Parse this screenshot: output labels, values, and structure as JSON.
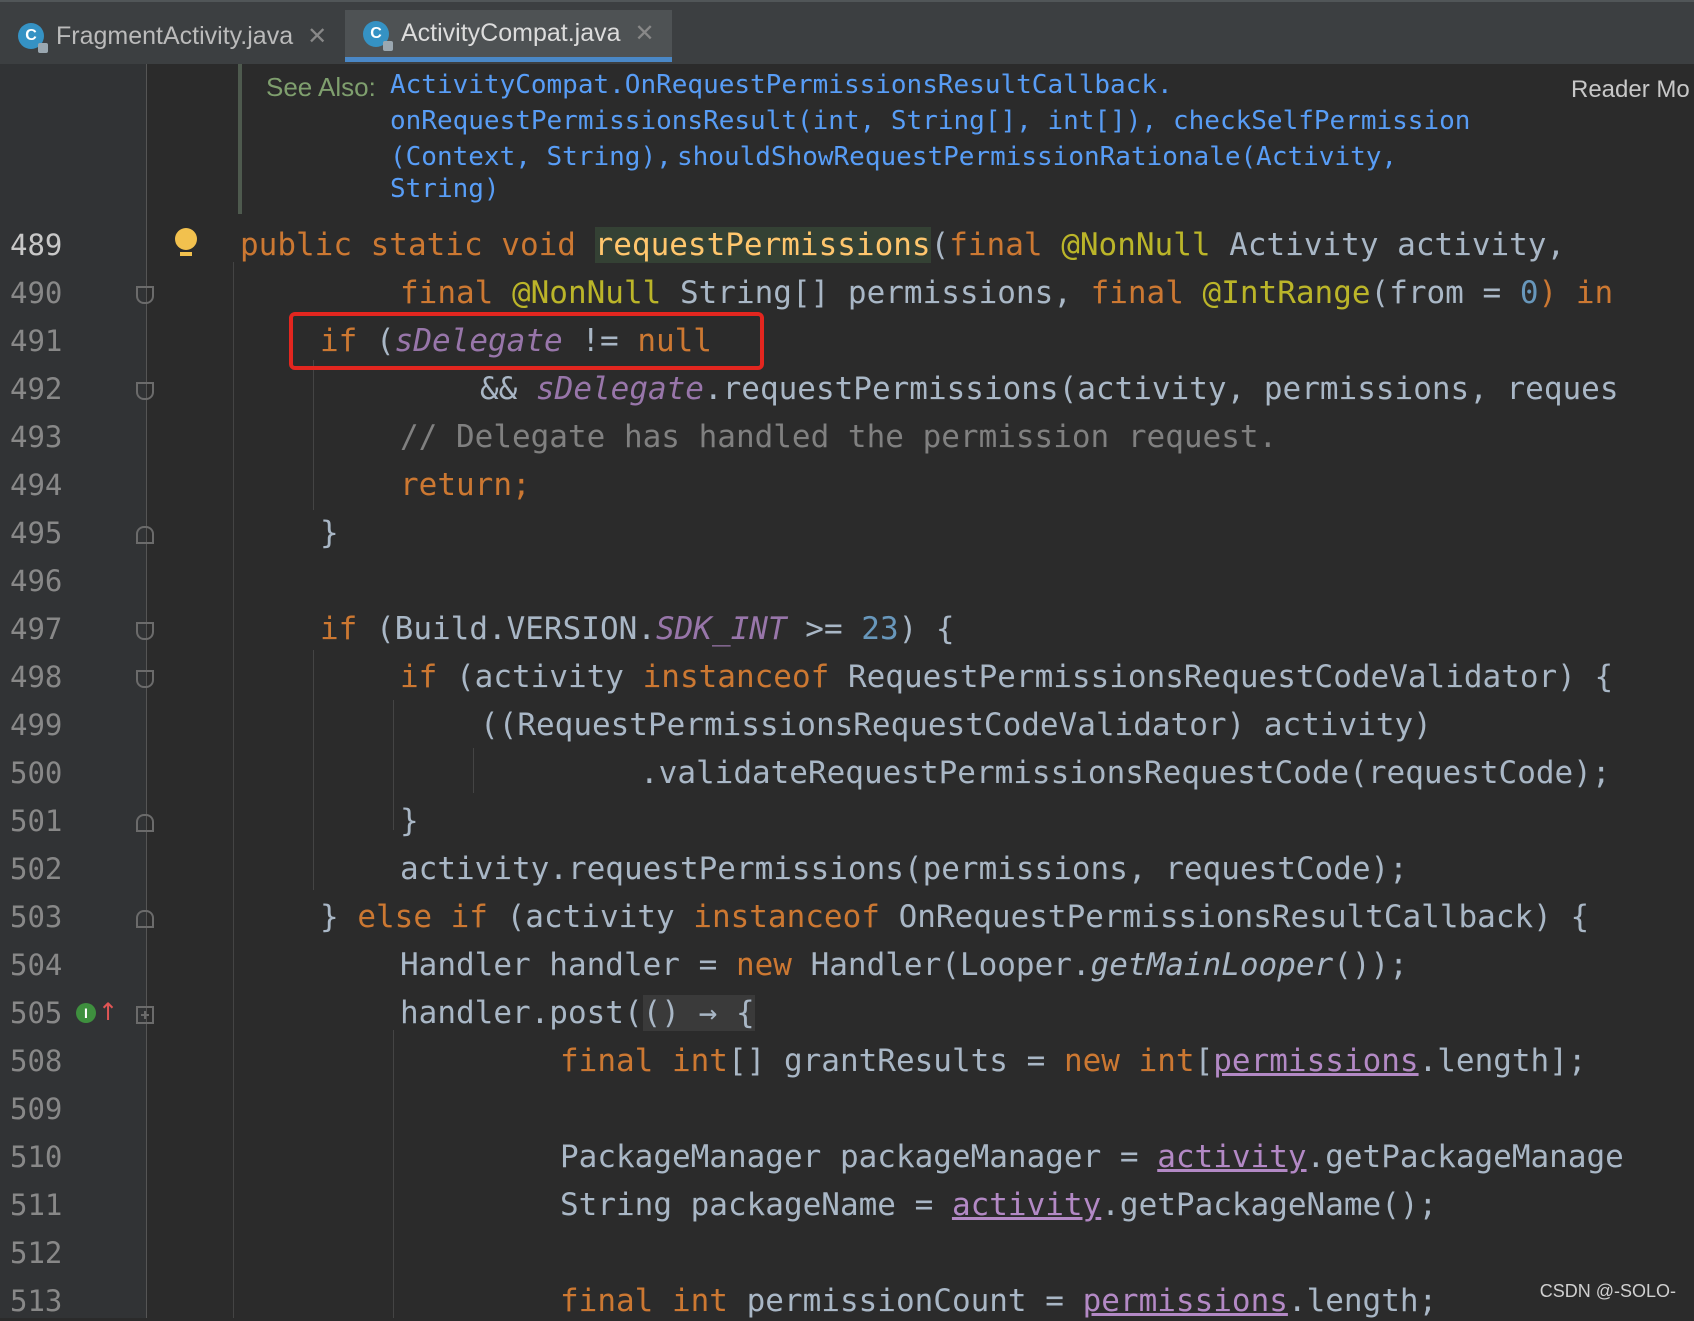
{
  "tabs": [
    {
      "label": "FragmentActivity.java",
      "active": false
    },
    {
      "label": "ActivityCompat.java",
      "active": true
    }
  ],
  "doc": {
    "see_also_label": "See Also:",
    "lines": [
      "ActivityCompat.OnRequestPermissionsResultCallback.",
      "onRequestPermissionsResult(int, String[], int[]),",
      "checkSelfPermission",
      "(Context, String),",
      "shouldShowRequestPermissionRationale(Activity,",
      "String)"
    ],
    "reader_mode": "Reader Mo"
  },
  "line_numbers": [
    "489",
    "490",
    "491",
    "492",
    "493",
    "494",
    "495",
    "496",
    "497",
    "498",
    "499",
    "500",
    "501",
    "502",
    "503",
    "504",
    "505",
    "508",
    "509",
    "510",
    "511",
    "512",
    "513"
  ],
  "code": {
    "l489": {
      "kw": "public static void ",
      "fn": "requestPermissions",
      "p1": "(",
      "kw2": "final ",
      "an": "@NonNull",
      "rest": " Activity activity,"
    },
    "l490": {
      "kw": "final ",
      "an": "@NonNull",
      "mid": " String[] permissions, ",
      "kw2": "final ",
      "an2": "@IntRange",
      "p": "(from = ",
      "num": "0",
      "rest": ") in"
    },
    "l491": {
      "kw": "if ",
      "p": "(",
      "fi": "sDelegate",
      "op": " != ",
      "kw2": "null"
    },
    "l492": {
      "op": "&& ",
      "fi": "sDelegate",
      "rest": ".requestPermissions(activity, permissions, reques"
    },
    "l493": {
      "cm": "// Delegate has handled the permission request."
    },
    "l494": {
      "kw": "return",
      "p": ";"
    },
    "l495": {
      "p": "}"
    },
    "l497": {
      "kw": "if ",
      "p": "(Build.VERSION.",
      "fi": "SDK_INT",
      "op": " >= ",
      "num": "23",
      "rest": ") {"
    },
    "l498": {
      "kw": "if ",
      "p": "(activity ",
      "kw2": "instanceof ",
      "rest": "RequestPermissionsRequestCodeValidator) {"
    },
    "l499": {
      "p": "((RequestPermissionsRequestCodeValidator) activity)"
    },
    "l500": {
      "p": ".validateRequestPermissionsRequestCode(requestCode);"
    },
    "l501": {
      "p": "}"
    },
    "l502": {
      "p": "activity.requestPermissions(permissions, requestCode);"
    },
    "l503": {
      "p": "} ",
      "kw": "else if ",
      "p2": "(activity ",
      "kw2": "instanceof ",
      "rest": "OnRequestPermissionsResultCallback) {"
    },
    "l504": {
      "p": "Handler handler = ",
      "kw": "new ",
      "p2": "Handler(Looper.",
      "it": "getMainLooper",
      "rest": "());"
    },
    "l505": {
      "p": "handler.post(",
      "lam": "() → {"
    },
    "l508": {
      "kw": "final int",
      "p": "[] grantResults = ",
      "kw2": "new int",
      "p2": "[",
      "ul": "permissions",
      "rest": ".length];"
    },
    "l510": {
      "p": "PackageManager packageManager = ",
      "ul": "activity",
      "rest": ".getPackageManage"
    },
    "l511": {
      "p": "String packageName = ",
      "ul": "activity",
      "rest": ".getPackageName();"
    },
    "l513": {
      "kw": "final int ",
      "p": "permissionCount = ",
      "ul": "permissions",
      "rest": ".length;"
    }
  },
  "watermark": "CSDN @-SOLO-"
}
